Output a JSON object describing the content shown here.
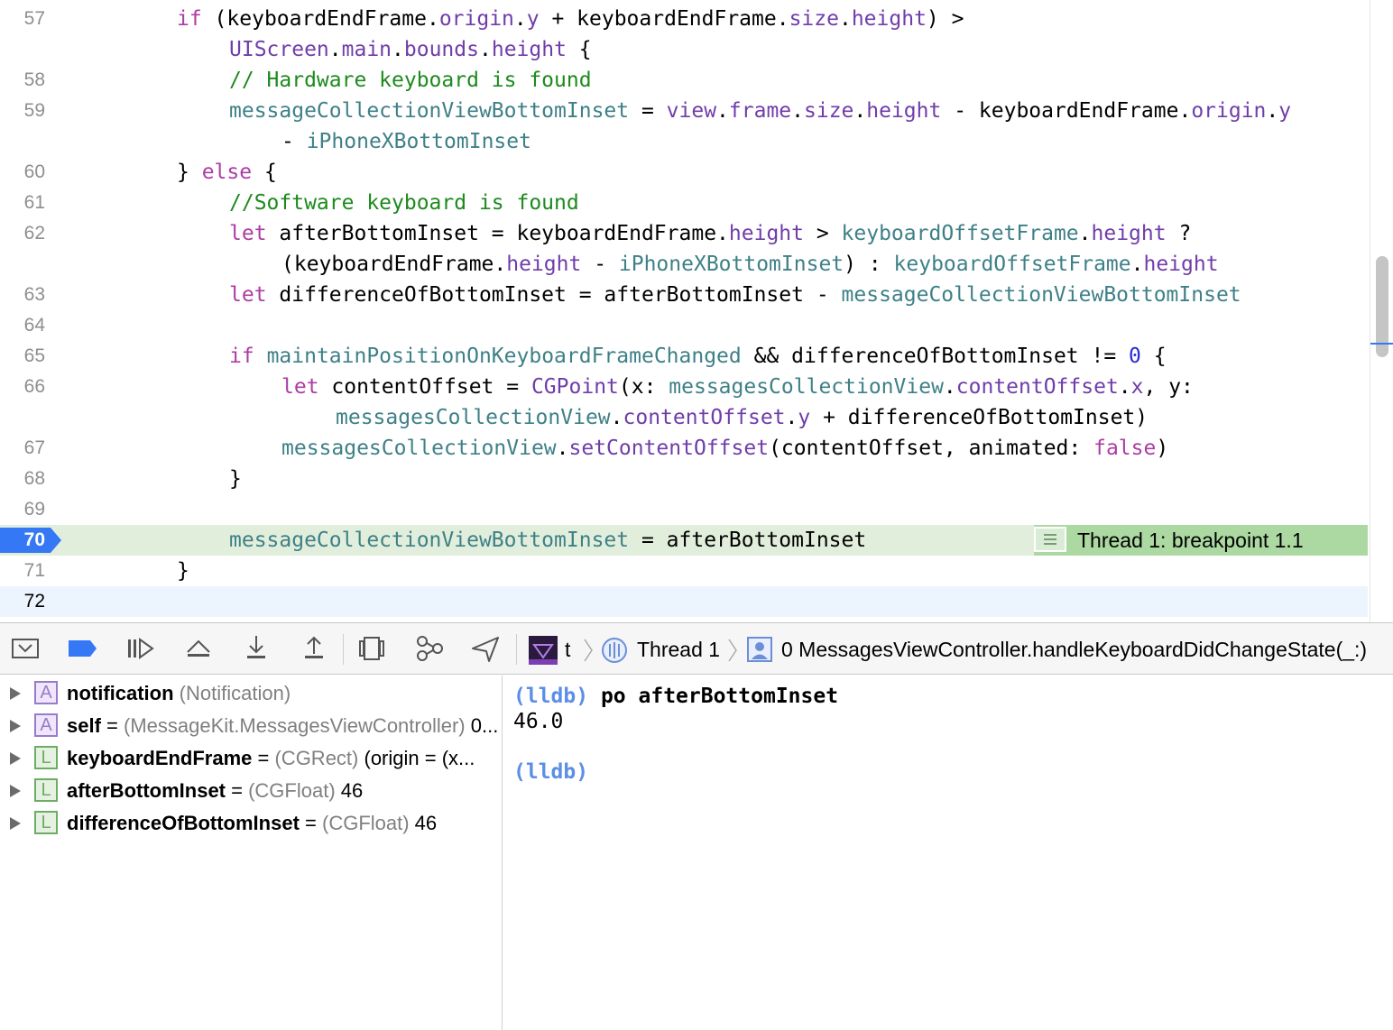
{
  "editor": {
    "lines": [
      {
        "num": "57"
      },
      {
        "num": "58"
      },
      {
        "num": "59"
      },
      {
        "num": "60"
      },
      {
        "num": "61"
      },
      {
        "num": "62"
      },
      {
        "num": "63"
      },
      {
        "num": "64"
      },
      {
        "num": "65"
      },
      {
        "num": "66"
      },
      {
        "num": "67"
      },
      {
        "num": "68"
      },
      {
        "num": "69"
      },
      {
        "num": "70"
      },
      {
        "num": "71"
      },
      {
        "num": "72"
      }
    ],
    "code": {
      "l57a": "if (keyboardEndFrame.origin.y + keyboardEndFrame.size.height) >",
      "l57b": "UIScreen.main.bounds.height {",
      "l58": "// Hardware keyboard is found",
      "l59a": "messageCollectionViewBottomInset = view.frame.size.height - keyboardEndFrame.origin.y",
      "l59b": "- iPhoneXBottomInset",
      "l60": "} else {",
      "l61": "//Software keyboard is found",
      "l62a": "let afterBottomInset = keyboardEndFrame.height > keyboardOffsetFrame.height ?",
      "l62b": "(keyboardEndFrame.height - iPhoneXBottomInset) : keyboardOffsetFrame.height",
      "l63": "let differenceOfBottomInset = afterBottomInset - messageCollectionViewBottomInset",
      "l65": "if maintainPositionOnKeyboardFrameChanged && differenceOfBottomInset != 0 {",
      "l66a": "let contentOffset = CGPoint(x: messagesCollectionView.contentOffset.x, y:",
      "l66b": "messagesCollectionView.contentOffset.y + differenceOfBottomInset)",
      "l67": "messagesCollectionView.setContentOffset(contentOffset, animated: false)",
      "l68": "}",
      "l70": "messageCollectionViewBottomInset = afterBottomInset",
      "l71": "}"
    },
    "breakpoint_banner": "Thread 1: breakpoint 1.1"
  },
  "debug_bar": {
    "target_label": "t",
    "thread_label": "Thread 1",
    "frame_label": "0 MessagesViewController.handleKeyboardDidChangeState(_:)"
  },
  "variables": [
    {
      "badge": "A",
      "name": "notification",
      "eq": "",
      "type": "(Notification)",
      "value": ""
    },
    {
      "badge": "A",
      "name": "self",
      "eq": " = ",
      "type": "(MessageKit.MessagesViewController)",
      "value": " 0..."
    },
    {
      "badge": "L",
      "name": "keyboardEndFrame",
      "eq": " = ",
      "type": "(CGRect)",
      "value": " (origin = (x..."
    },
    {
      "badge": "L",
      "name": "afterBottomInset",
      "eq": " = ",
      "type": "(CGFloat)",
      "value": " 46"
    },
    {
      "badge": "L",
      "name": "differenceOfBottomInset",
      "eq": " = ",
      "type": "(CGFloat)",
      "value": " 46"
    }
  ],
  "console": {
    "prompt": "(lldb)",
    "command": "po afterBottomInset",
    "output": "46.0",
    "prompt2": "(lldb)"
  },
  "colors": {
    "keyword": "#ad3da4",
    "comment": "#1d8a1d",
    "property": "#3e8087",
    "system": "#703daa",
    "number": "#272ad8",
    "breakpoint": "#3478f6",
    "current_line": "#e2eedc"
  }
}
